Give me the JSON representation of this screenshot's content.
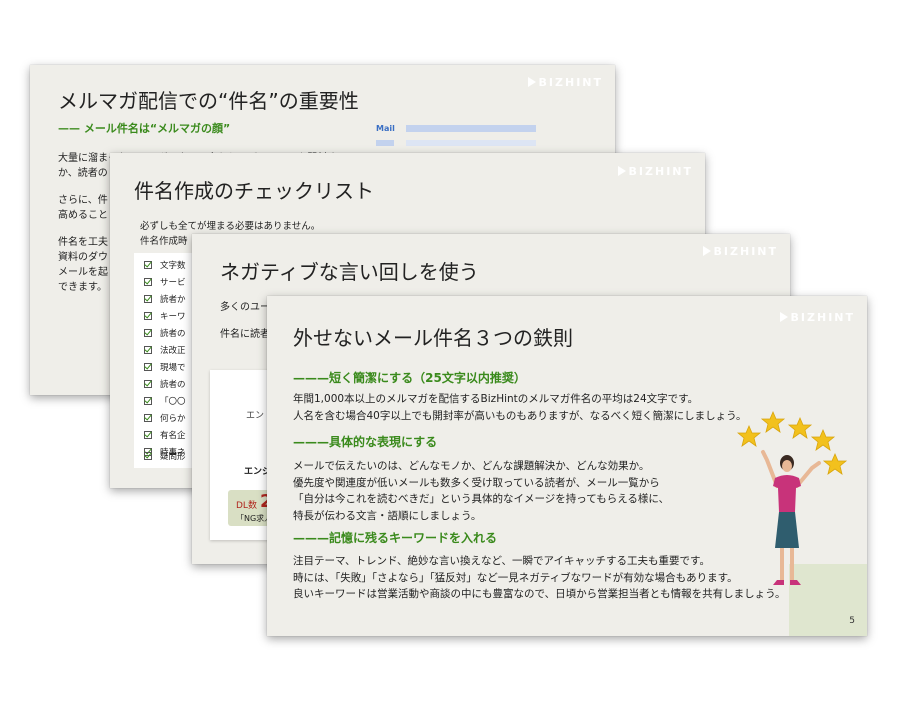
{
  "brand": {
    "logo_text": "BIZHINT"
  },
  "slide1": {
    "title": "メルマガ配信での“件名”の重要性",
    "subheading": "—— メール件名は“メルマガの顔”",
    "lines": [
      "大量に溜まったメールボックスの中から、どのメールを開封するの",
      "か、読者の",
      "さらに、件",
      "高めること",
      "件名を工夫",
      "資料のダウ",
      "メールを起",
      "できます。"
    ],
    "mail_label": "Mail"
  },
  "slide2": {
    "title": "件名作成のチェックリスト",
    "intro": [
      "必ずしも全てが埋まる必要はありません。",
      "件名作成時"
    ],
    "checklist": [
      "文字数",
      "サービ",
      "読者か",
      "キーワ",
      "読者の",
      "法改正",
      "現場で",
      "読者の",
      "「〇〇",
      "何らか",
      "有名企",
      "時事ネ",
      "疑問形"
    ]
  },
  "slide3": {
    "title": "ネガティブな言い回しを使う",
    "line1": "多くのユー",
    "line2": "件名に読者",
    "card_line1": "エン",
    "card_line2": "エンジ",
    "badge_text": "DL数",
    "badge_num": "2",
    "badge_sub": "「NG求人"
  },
  "slide4": {
    "title": "外せないメール件名３つの鉄則",
    "sections": [
      {
        "heading": "———短く簡潔にする（25文字以内推奨）",
        "lines": [
          "年間1,000本以上のメルマガを配信するBizHintのメルマガ件名の平均は24文字です。",
          "人名を含む場合40字以上でも開封率が高いものもありますが、なるべく短く簡潔にしましょう。"
        ]
      },
      {
        "heading": "———具体的な表現にする",
        "lines": [
          "メールで伝えたいのは、どんなモノか、どんな課題解決か、どんな効果か。",
          "優先度や関連度が低いメールも数多く受け取っている読者が、メール一覧から",
          "「自分は今これを読むべきだ」という具体的なイメージを持ってもらえる様に、",
          "特長が伝わる文言・語順にしましょう。"
        ]
      },
      {
        "heading": "———記憶に残るキーワードを入れる",
        "lines": [
          "注目テーマ、トレンド、絶妙な言い換えなど、一瞬でアイキャッチする工夫も重要です。",
          "時には、「失敗」「さよなら」「猛反対」など一見ネガティブなワードが有効な場合もあります。",
          "良いキーワードは営業活動や商談の中にも豊富なので、日頃から営業担当者とも情報を共有しましょう。"
        ]
      }
    ],
    "page_number": "5"
  },
  "colors": {
    "accent_green": "#3a8a1c",
    "slide_bg": "#efeee9",
    "pale_green": "#dfe6cf",
    "shirt": "#c8337a",
    "skirt": "#2f5d6e"
  }
}
